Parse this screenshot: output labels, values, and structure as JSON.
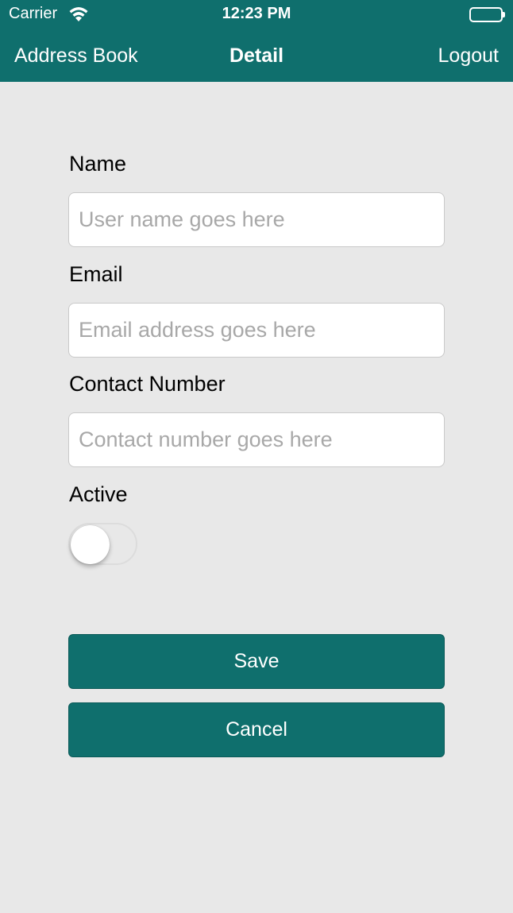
{
  "status_bar": {
    "carrier": "Carrier",
    "time": "12:23 PM",
    "icons": [
      "wifi-icon",
      "battery-icon"
    ]
  },
  "nav": {
    "back_label": "Address Book",
    "title": "Detail",
    "right_label": "Logout"
  },
  "form": {
    "name_label": "Name",
    "name_placeholder": "User name goes here",
    "name_value": "",
    "email_label": "Email",
    "email_placeholder": "Email address goes here",
    "email_value": "",
    "contact_label": "Contact Number",
    "contact_placeholder": "Contact number goes here",
    "contact_value": "",
    "active_label": "Active",
    "active_on": false
  },
  "actions": {
    "save_label": "Save",
    "cancel_label": "Cancel"
  },
  "colors": {
    "accent": "#0f6f6d",
    "background": "#e8e8e8",
    "placeholder": "#a8a8a8"
  }
}
